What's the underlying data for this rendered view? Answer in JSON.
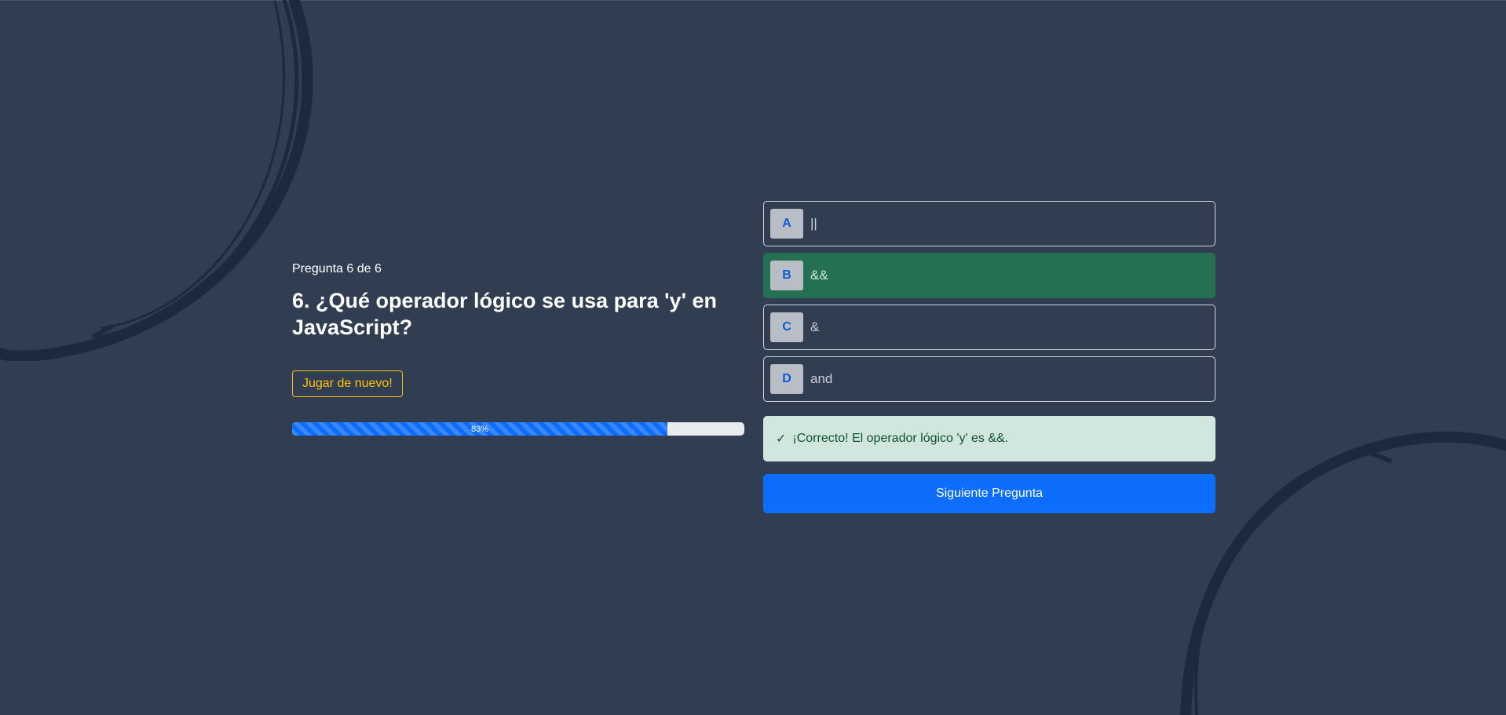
{
  "colors": {
    "background": "#313e52",
    "correct_option": "#237152",
    "feedback_bg": "#d1e7dd",
    "primary": "#0d6efd",
    "warning": "#ffc107"
  },
  "question": {
    "counter": "Pregunta 6 de 6",
    "title": "6. ¿Qué operador lógico se usa para 'y' en JavaScript?"
  },
  "replay_label": "Jugar de nuevo!",
  "progress": {
    "value": 83,
    "label": "83%"
  },
  "options": [
    {
      "letter": "A",
      "text": "||",
      "state": "default"
    },
    {
      "letter": "B",
      "text": "&&",
      "state": "correct"
    },
    {
      "letter": "C",
      "text": "&",
      "state": "default"
    },
    {
      "letter": "D",
      "text": "and",
      "state": "default"
    }
  ],
  "feedback": {
    "icon": "check-icon",
    "symbol": "✓",
    "text": "¡Correcto! El operador lógico 'y' es &&."
  },
  "next_label": "Siguiente Pregunta"
}
